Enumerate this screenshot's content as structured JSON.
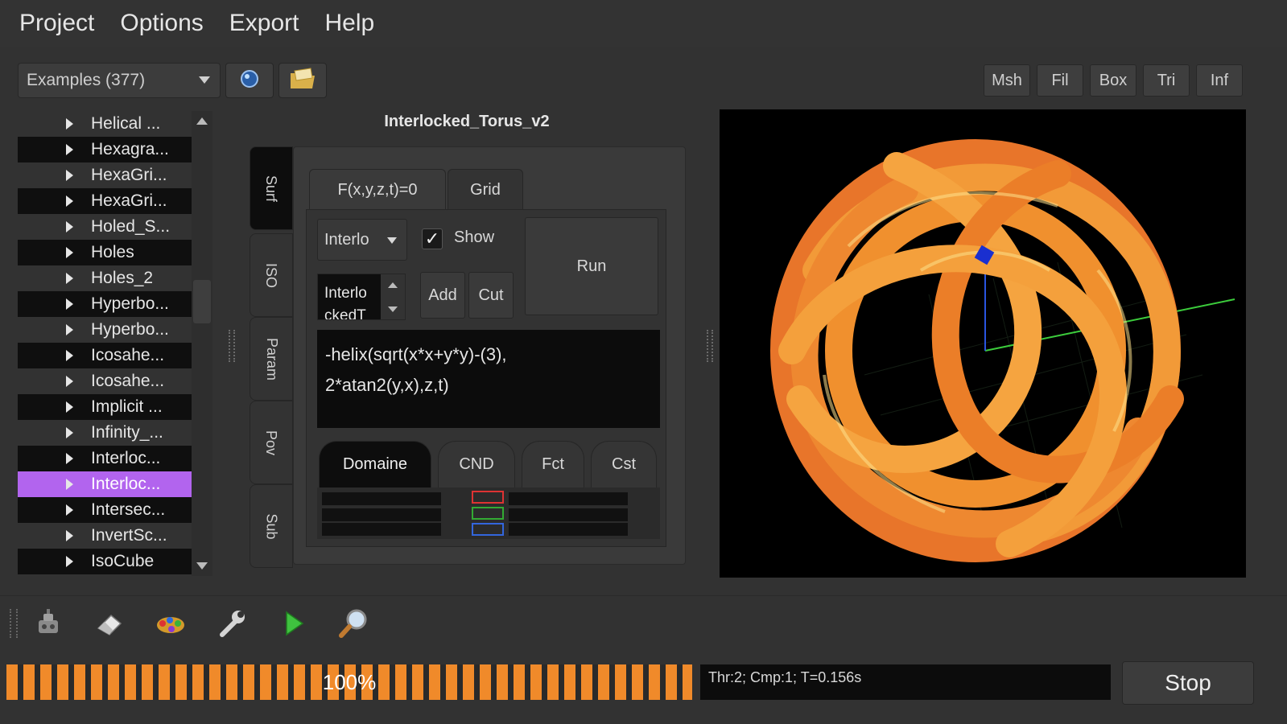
{
  "menu": [
    "Project",
    "Options",
    "Export",
    "Help"
  ],
  "toolbar": {
    "examples_combo": "Examples (377)",
    "right_buttons": [
      "Msh",
      "Fil",
      "Box",
      "Tri",
      "Inf"
    ]
  },
  "list": {
    "items": [
      "Helical ...",
      "Hexagra...",
      "HexaGri...",
      "HexaGri...",
      "Holed_S...",
      "Holes",
      "Holes_2",
      "Hyperbo...",
      "Hyperbo...",
      "Icosahe...",
      "Icosahe...",
      "Implicit ...",
      "Infinity_...",
      "Interloc...",
      "Interloc...",
      "Intersec...",
      "InvertSc...",
      "IsoCube"
    ],
    "selected_index": 14
  },
  "panel": {
    "title": "Interlocked_Torus_v2",
    "vertical_tabs": [
      "Surf",
      "ISO",
      "Param",
      "Pov",
      "Sub"
    ],
    "tabs": [
      "F(x,y,z,t)=0",
      "Grid"
    ],
    "function_combo": "Interlo",
    "show_label": "Show",
    "show_checked": true,
    "run_label": "Run",
    "spin_value": "Interlo\nckedT",
    "add_label": "Add",
    "cut_label": "Cut",
    "equation_line1": "-helix(sqrt(x*x+y*y)-(3),",
    "equation_line2": "2*atan2(y,x),z,t)",
    "bottom_tabs": [
      "Domaine",
      "CND",
      "Fct",
      "Cst"
    ]
  },
  "bottom_toolbar_icons": [
    "robot-icon",
    "eraser-icon",
    "colors-icon",
    "wrench-icon",
    "play-icon",
    "zoom-icon"
  ],
  "status": {
    "progress_percent": 100,
    "progress_label": "100%",
    "info": "Thr:2; Cmp:1; T=0.156s",
    "stop_label": "Stop"
  },
  "colors": {
    "selection": "#b264ee",
    "progress": "#f08a2a",
    "torus": "#f0852a"
  }
}
